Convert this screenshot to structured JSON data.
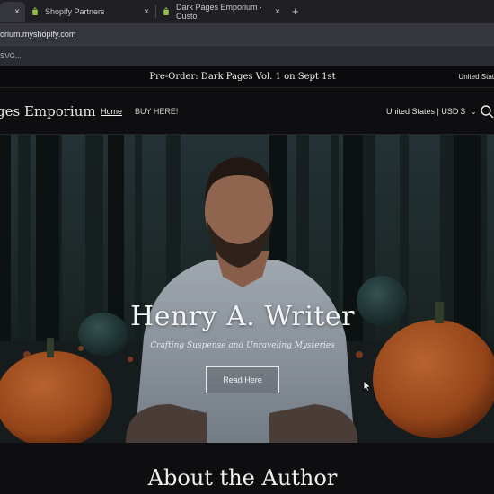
{
  "browser": {
    "tabs": [
      {
        "label": "",
        "active": true
      },
      {
        "label": "Shopify Partners",
        "active": false
      },
      {
        "label": "Dark Pages Emporium · Custo",
        "active": false
      }
    ],
    "close_glyph": "×",
    "new_tab_glyph": "+",
    "url": "orium.myshopify.com",
    "bookmark": "SVG..."
  },
  "announcement": {
    "text": "Pre-Order: Dark Pages Vol. 1 on Sept 1st",
    "region": "United Stat"
  },
  "header": {
    "logo": "ges Emporium",
    "nav": {
      "home": "Home",
      "buy": "BUY HERE!"
    },
    "currency": "United States | USD $",
    "currency_chevron": "⌄"
  },
  "hero": {
    "title": "Henry A. Writer",
    "subtitle": "Crafting Suspense and Unraveling Mysteries",
    "button": "Read Here"
  },
  "section": {
    "heading": "About the Author"
  },
  "colors": {
    "shopify_green": "#95bf47",
    "pumpkin": "#c8662a",
    "page_bg": "#0e0e10"
  }
}
